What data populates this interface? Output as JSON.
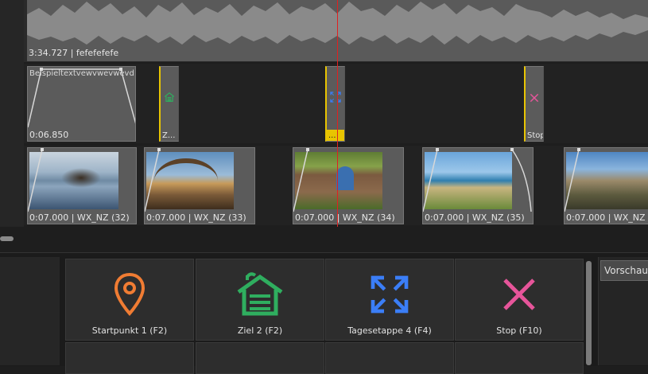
{
  "audio_track": {
    "caption": "3:34.727 | fefefefefe"
  },
  "text_track": {
    "text_clip": {
      "title": "Beispieltextvewvwevwevd",
      "duration": "0:06.850"
    },
    "markers": [
      {
        "label": "Z...",
        "icon": "house-icon",
        "color": "#2fae5f"
      },
      {
        "label": "...",
        "icon": "expand-icon",
        "color": "#3b7ef7"
      },
      {
        "label": "Stop",
        "icon": "close-icon",
        "color": "#e6559a"
      }
    ]
  },
  "image_track": {
    "clips": [
      {
        "caption": "0:07.000 | WX_NZ (32)"
      },
      {
        "caption": "0:07.000 | WX_NZ (33)"
      },
      {
        "caption": "0:07.000 | WX_NZ (34)"
      },
      {
        "caption": "0:07.000 | WX_NZ (35)"
      },
      {
        "caption": "0:07.000 | WX_NZ"
      }
    ]
  },
  "palette": {
    "tiles": [
      {
        "label": "Startpunkt 1 (F2)",
        "icon": "map-pin-icon",
        "color": "#f07c33"
      },
      {
        "label": "Ziel 2 (F2)",
        "icon": "house-icon",
        "color": "#2fae5f"
      },
      {
        "label": "Tagesetappe 4 (F4)",
        "icon": "expand-icon",
        "color": "#3b7ef7"
      },
      {
        "label": "Stop (F10)",
        "icon": "close-icon",
        "color": "#e6559a"
      }
    ]
  },
  "preview_tab": {
    "label": "Vorschau"
  },
  "colors": {
    "playhead": "#e02020",
    "marker_yellow": "#e8c400"
  }
}
